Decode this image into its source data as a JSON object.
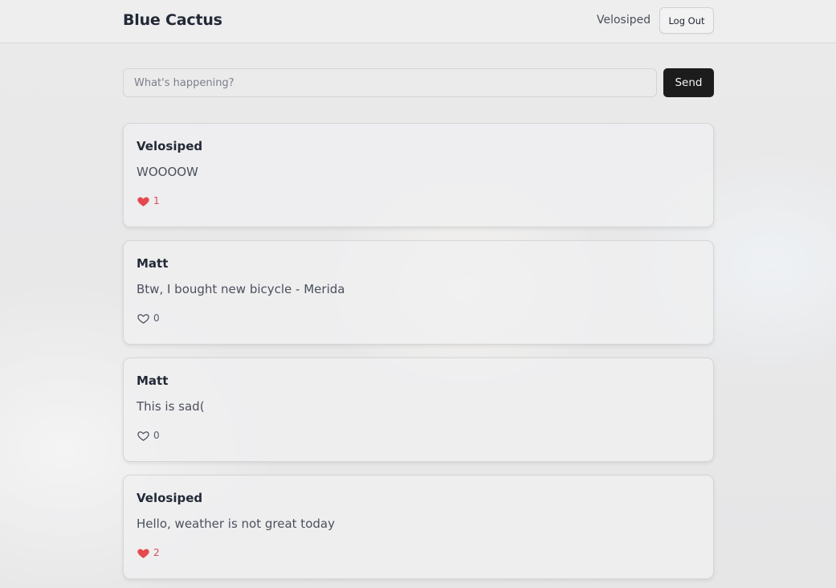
{
  "header": {
    "brand": "Blue Cactus",
    "username": "Velosiped",
    "logout_label": "Log Out"
  },
  "composer": {
    "placeholder": "What's happening?",
    "value": "",
    "send_label": "Send"
  },
  "colors": {
    "liked_heart": "#e5484d",
    "send_button": "#1c1c1d"
  },
  "posts": [
    {
      "author": "Velosiped",
      "text": "WOOOOW",
      "likes": "1",
      "liked": true
    },
    {
      "author": "Matt",
      "text": "Btw, I bought new bicycle - Merida",
      "likes": "0",
      "liked": false
    },
    {
      "author": "Matt",
      "text": "This is sad(",
      "likes": "0",
      "liked": false
    },
    {
      "author": "Velosiped",
      "text": "Hello, weather is not great today",
      "likes": "2",
      "liked": true
    }
  ]
}
